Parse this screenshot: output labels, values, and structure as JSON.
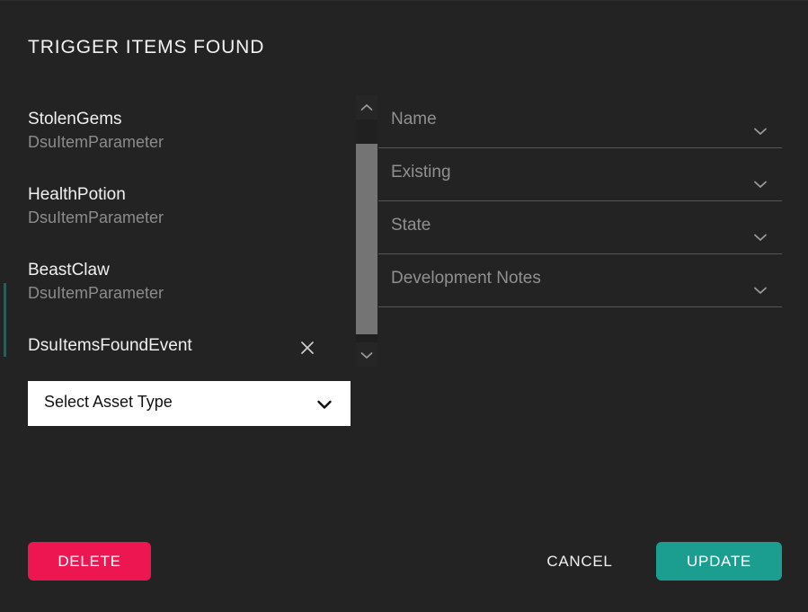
{
  "dialog": {
    "title": "TRIGGER ITEMS FOUND",
    "background_color": "#232323"
  },
  "trigger_items": [
    {
      "name": "StolenGems",
      "type": "DsuItemParameter"
    },
    {
      "name": "HealthPotion",
      "type": "DsuItemParameter"
    },
    {
      "name": "BeastClaw",
      "type": "DsuItemParameter"
    }
  ],
  "event_row": {
    "name": "DsuItemsFoundEvent",
    "remove_icon": "close-icon"
  },
  "scrollbar": {
    "up_icon": "chevron-up-icon",
    "down_icon": "chevron-down-icon",
    "thumb_color": "#747474"
  },
  "fields": [
    {
      "label": "Name",
      "chevron_icon": "chevron-down-icon"
    },
    {
      "label": "Existing",
      "chevron_icon": "chevron-down-icon"
    },
    {
      "label": "State",
      "chevron_icon": "chevron-down-icon"
    },
    {
      "label": "Development Notes",
      "chevron_icon": "chevron-down-icon"
    }
  ],
  "asset_select": {
    "value": "Select Asset Type",
    "chevron_icon": "chevron-down-icon"
  },
  "footer": {
    "delete_label": "DELETE",
    "cancel_label": "CANCEL",
    "update_label": "UPDATE",
    "delete_color": "#ED1651",
    "update_color": "#1B9E8F"
  }
}
